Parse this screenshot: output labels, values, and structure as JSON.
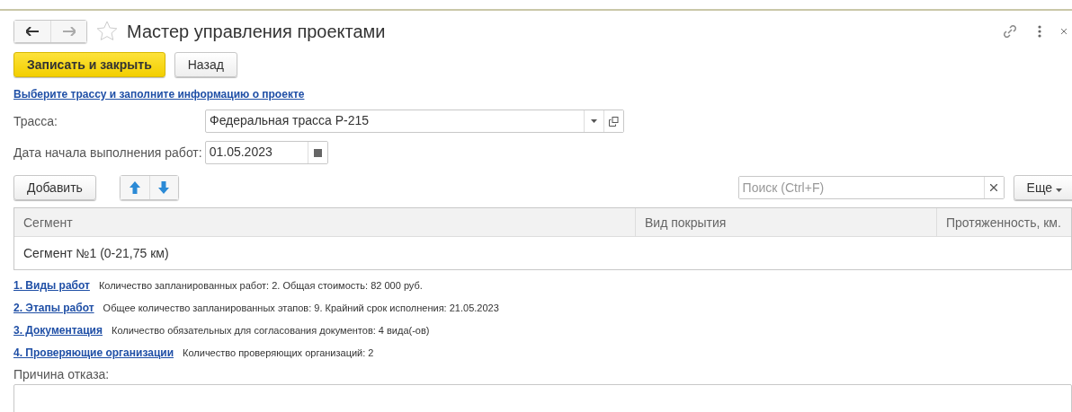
{
  "window": {
    "title": "Мастер управления проектами"
  },
  "toolbar": {
    "buttons": [
      {
        "label": "Записать и закрыть",
        "kind": "primary"
      },
      {
        "label": "Назад",
        "kind": "default"
      }
    ]
  },
  "instruction_link": "Выберите трассу и заполните информацию о проекте",
  "fields": [
    {
      "label": "Трасса:",
      "value": "Федеральная трасса Р-215",
      "kind": "select"
    },
    {
      "label": "Дата начала выполнения работ:",
      "value": "01.05.2023",
      "kind": "date"
    }
  ],
  "table_toolbar": {
    "add_button": "Добавить",
    "search": {
      "placeholder": "Поиск (Ctrl+F)"
    },
    "more_button": "Еще"
  },
  "table": {
    "columns": [
      "Сегмент",
      "Вид покрытия",
      "Протяженность, км."
    ],
    "rows": [
      {
        "cells": [
          "Сегмент №1 (0-21,75 км)",
          "",
          ""
        ],
        "selected": false
      }
    ]
  },
  "sections": [
    {
      "link": "1. Виды работ",
      "info": "Количество запланированных работ: 2. Общая стоимость: 82 000 руб."
    },
    {
      "link": "2. Этапы работ",
      "info": "Общее количество запланированных этапов: 9. Крайний срок исполнения: 21.05.2023"
    },
    {
      "link": "3. Документация",
      "info": "Количество обязательных для согласования документов: 4 вида(-ов)"
    },
    {
      "link": "4. Проверяющие организации",
      "info": "Количество проверяющих организаций: 2"
    }
  ],
  "rejection": {
    "label": "Причина отказа:"
  }
}
